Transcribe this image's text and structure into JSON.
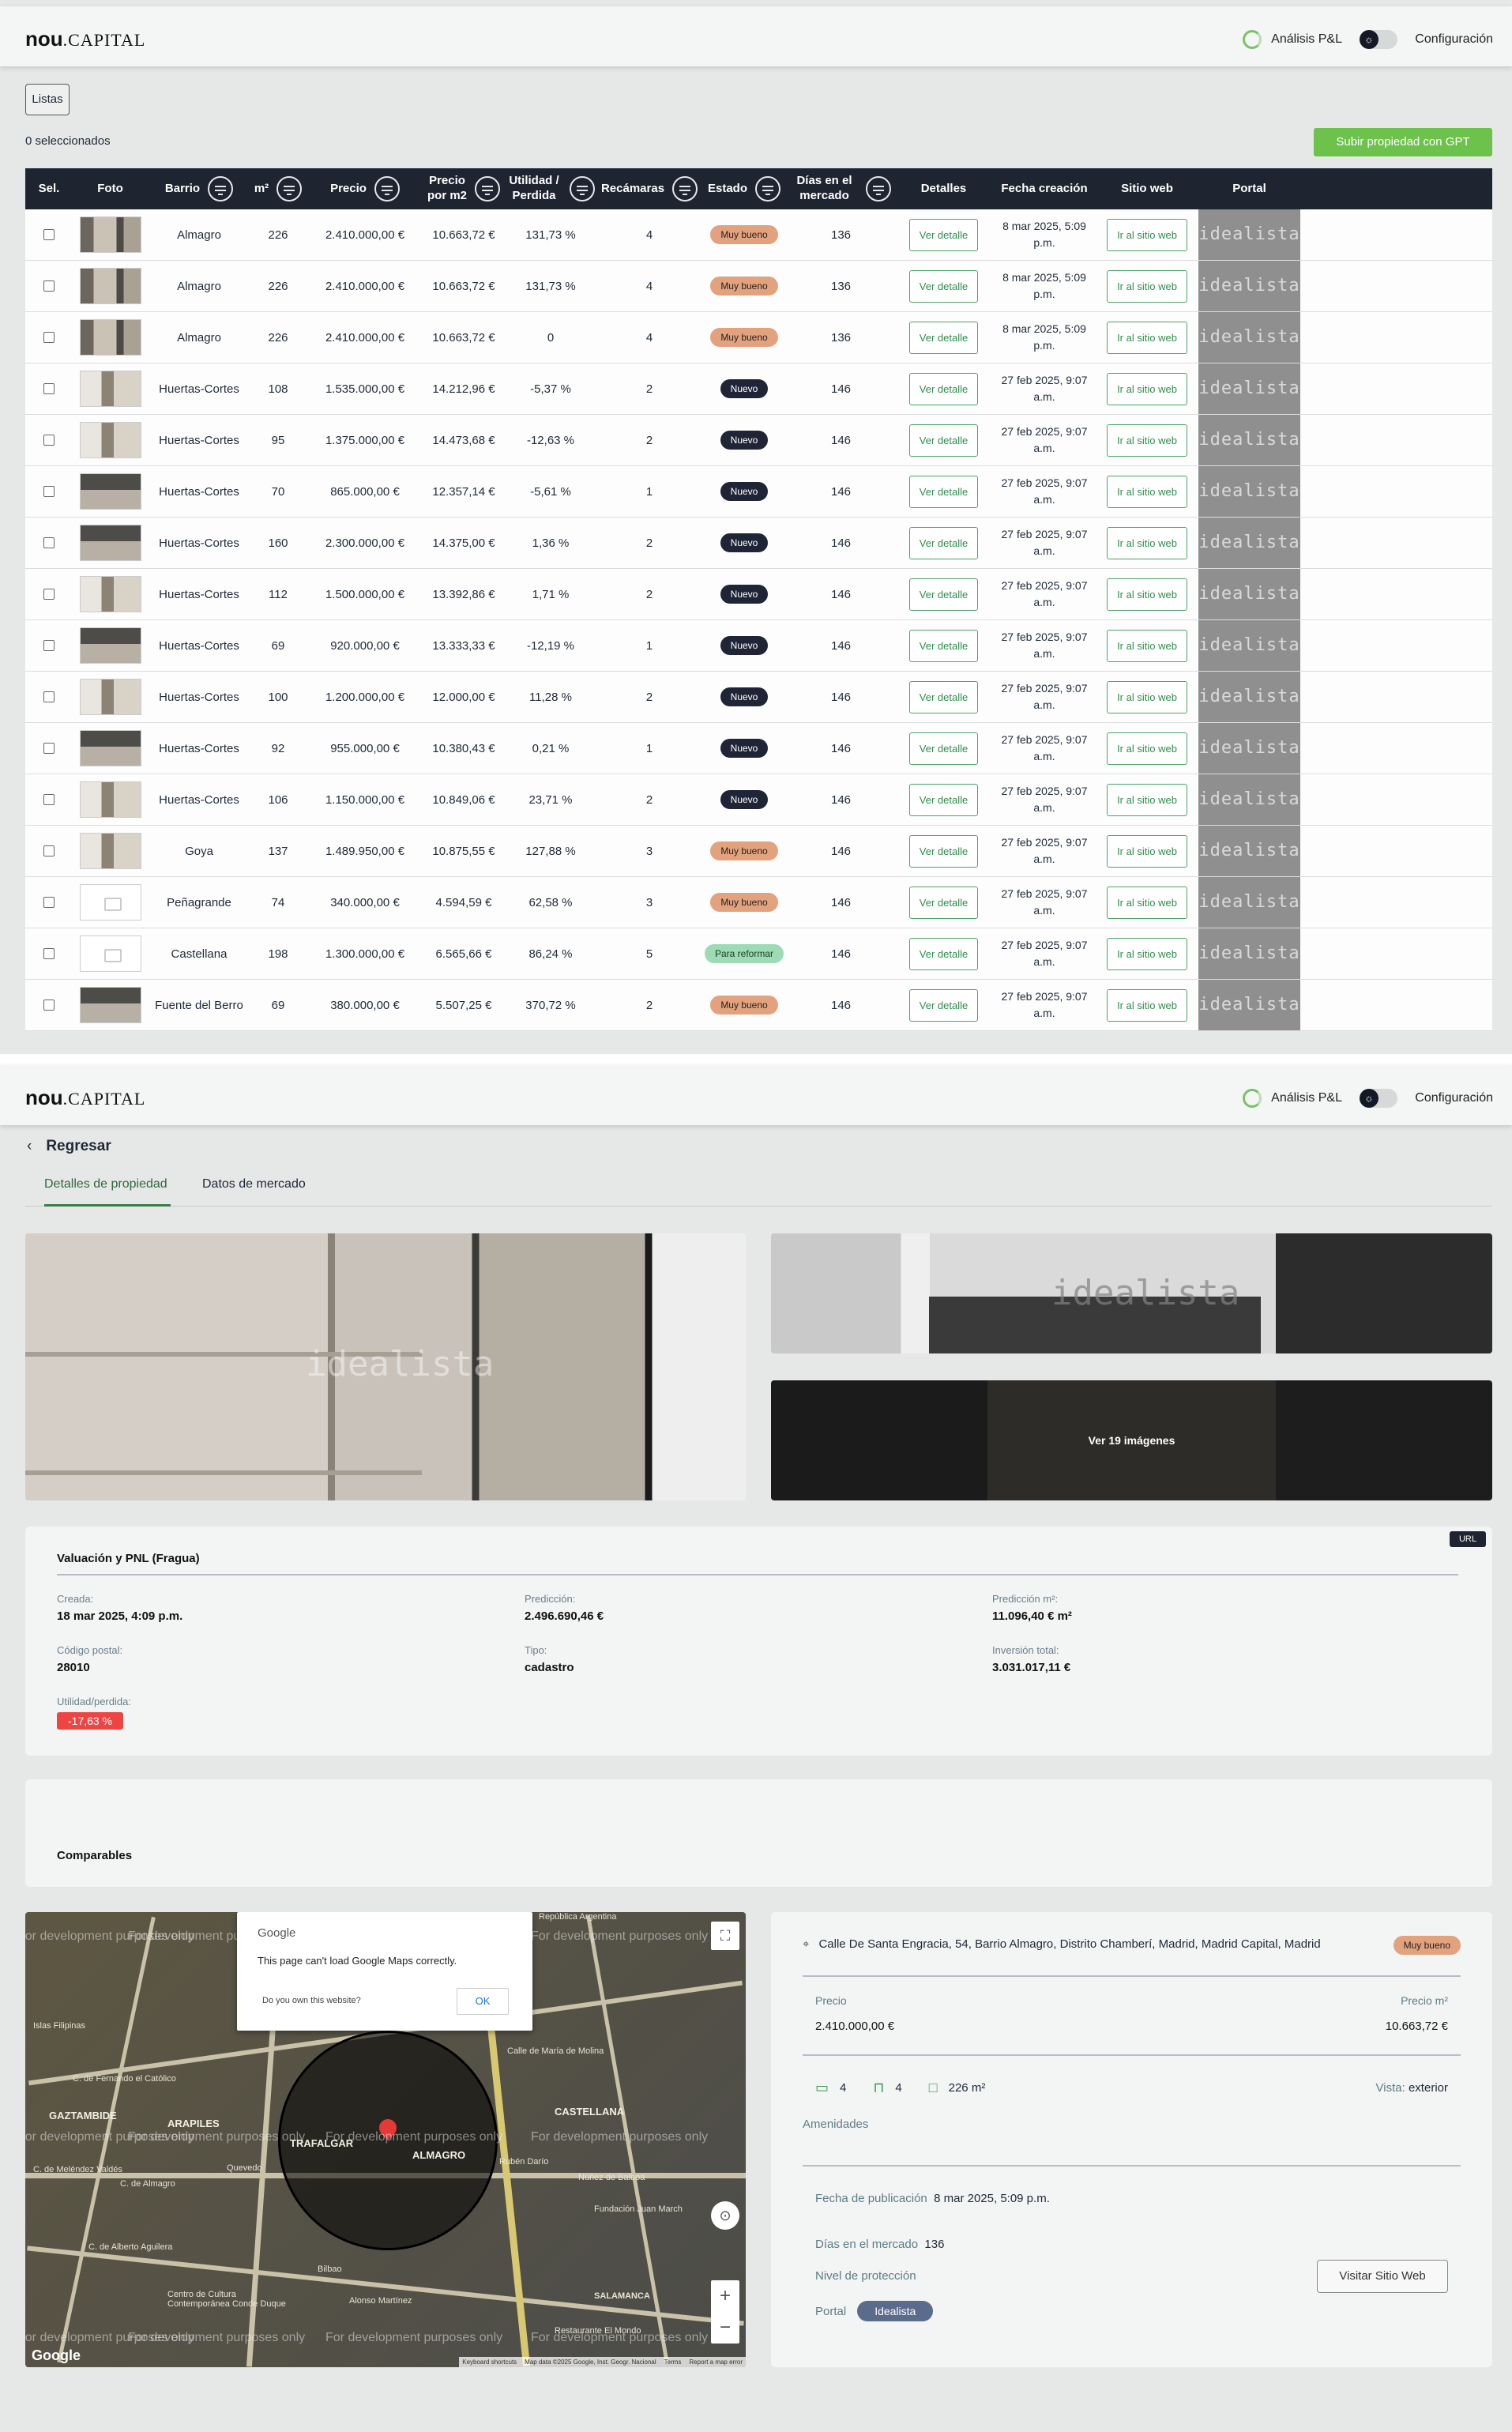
{
  "header": {
    "logo_bold": "nou",
    "logo_rest": ".CAPITAL",
    "pl_analysis": "Análisis P&L",
    "theme_icon": "☼",
    "config": "Configuración"
  },
  "list": {
    "lists_button": "Listas",
    "selected_count": "0 seleccionados",
    "gpt_button": "Subir propiedad con GPT",
    "columns": [
      "Sel.",
      "Foto",
      "Barrio",
      "m²",
      "Precio",
      "Precio por m2",
      "Utilidad / Perdida",
      "Recámaras",
      "Estado",
      "Días en el mercado",
      "Detalles",
      "Fecha creación",
      "Sitio web",
      "Portal"
    ],
    "detail_label": "Ver detalle",
    "site_label": "Ir al sitio web",
    "portal_label": "idealista",
    "rows": [
      {
        "barrio": "Almagro",
        "m2": "226",
        "precio": "2.410.000,00 €",
        "pm2": "10.663,72 €",
        "util": "131,73 %",
        "rec": "4",
        "estado": "Muy bueno",
        "dias": "136",
        "fecha1": "8 mar 2025, 5:09",
        "fecha2": "p.m."
      },
      {
        "barrio": "Almagro",
        "m2": "226",
        "precio": "2.410.000,00 €",
        "pm2": "10.663,72 €",
        "util": "131,73 %",
        "rec": "4",
        "estado": "Muy bueno",
        "dias": "136",
        "fecha1": "8 mar 2025, 5:09",
        "fecha2": "p.m."
      },
      {
        "barrio": "Almagro",
        "m2": "226",
        "precio": "2.410.000,00 €",
        "pm2": "10.663,72 €",
        "util": "0",
        "rec": "4",
        "estado": "Muy bueno",
        "dias": "136",
        "fecha1": "8 mar 2025, 5:09",
        "fecha2": "p.m."
      },
      {
        "barrio": "Huertas-Cortes",
        "m2": "108",
        "precio": "1.535.000,00 €",
        "pm2": "14.212,96 €",
        "util": "-5,37 %",
        "rec": "2",
        "estado": "Nuevo",
        "dias": "146",
        "fecha1": "27 feb 2025, 9:07",
        "fecha2": "a.m."
      },
      {
        "barrio": "Huertas-Cortes",
        "m2": "95",
        "precio": "1.375.000,00 €",
        "pm2": "14.473,68 €",
        "util": "-12,63 %",
        "rec": "2",
        "estado": "Nuevo",
        "dias": "146",
        "fecha1": "27 feb 2025, 9:07",
        "fecha2": "a.m."
      },
      {
        "barrio": "Huertas-Cortes",
        "m2": "70",
        "precio": "865.000,00 €",
        "pm2": "12.357,14 €",
        "util": "-5,61 %",
        "rec": "1",
        "estado": "Nuevo",
        "dias": "146",
        "fecha1": "27 feb 2025, 9:07",
        "fecha2": "a.m."
      },
      {
        "barrio": "Huertas-Cortes",
        "m2": "160",
        "precio": "2.300.000,00 €",
        "pm2": "14.375,00 €",
        "util": "1,36 %",
        "rec": "2",
        "estado": "Nuevo",
        "dias": "146",
        "fecha1": "27 feb 2025, 9:07",
        "fecha2": "a.m."
      },
      {
        "barrio": "Huertas-Cortes",
        "m2": "112",
        "precio": "1.500.000,00 €",
        "pm2": "13.392,86 €",
        "util": "1,71 %",
        "rec": "2",
        "estado": "Nuevo",
        "dias": "146",
        "fecha1": "27 feb 2025, 9:07",
        "fecha2": "a.m."
      },
      {
        "barrio": "Huertas-Cortes",
        "m2": "69",
        "precio": "920.000,00 €",
        "pm2": "13.333,33 €",
        "util": "-12,19 %",
        "rec": "1",
        "estado": "Nuevo",
        "dias": "146",
        "fecha1": "27 feb 2025, 9:07",
        "fecha2": "a.m."
      },
      {
        "barrio": "Huertas-Cortes",
        "m2": "100",
        "precio": "1.200.000,00 €",
        "pm2": "12.000,00 €",
        "util": "11,28 %",
        "rec": "2",
        "estado": "Nuevo",
        "dias": "146",
        "fecha1": "27 feb 2025, 9:07",
        "fecha2": "a.m."
      },
      {
        "barrio": "Huertas-Cortes",
        "m2": "92",
        "precio": "955.000,00 €",
        "pm2": "10.380,43 €",
        "util": "0,21 %",
        "rec": "1",
        "estado": "Nuevo",
        "dias": "146",
        "fecha1": "27 feb 2025, 9:07",
        "fecha2": "a.m."
      },
      {
        "barrio": "Huertas-Cortes",
        "m2": "106",
        "precio": "1.150.000,00 €",
        "pm2": "10.849,06 €",
        "util": "23,71 %",
        "rec": "2",
        "estado": "Nuevo",
        "dias": "146",
        "fecha1": "27 feb 2025, 9:07",
        "fecha2": "a.m."
      },
      {
        "barrio": "Goya",
        "m2": "137",
        "precio": "1.489.950,00 €",
        "pm2": "10.875,55 €",
        "util": "127,88 %",
        "rec": "3",
        "estado": "Muy bueno",
        "dias": "146",
        "fecha1": "27 feb 2025, 9:07",
        "fecha2": "a.m."
      },
      {
        "barrio": "Peñagrande",
        "m2": "74",
        "precio": "340.000,00 €",
        "pm2": "4.594,59 €",
        "util": "62,58 %",
        "rec": "3",
        "estado": "Muy bueno",
        "dias": "146",
        "fecha1": "27 feb 2025, 9:07",
        "fecha2": "a.m."
      },
      {
        "barrio": "Castellana",
        "m2": "198",
        "precio": "1.300.000,00 €",
        "pm2": "6.565,66 €",
        "util": "86,24 %",
        "rec": "5",
        "estado": "Para reformar",
        "dias": "146",
        "fecha1": "27 feb 2025, 9:07",
        "fecha2": "a.m."
      },
      {
        "barrio": "Fuente del Berro",
        "m2": "69",
        "precio": "380.000,00 €",
        "pm2": "5.507,25 €",
        "util": "370,72 %",
        "rec": "2",
        "estado": "Muy bueno",
        "dias": "146",
        "fecha1": "27 feb 2025, 9:07",
        "fecha2": "a.m."
      }
    ]
  },
  "detail": {
    "back": "Regresar",
    "tabs": [
      "Detalles de propiedad",
      "Datos de mercado"
    ],
    "gallery_watermark": "idealista",
    "more_images": "Ver 19 imágenes",
    "valuation": {
      "title": "Valuación y PNL (Fragua)",
      "url_badge": "URL",
      "fields": [
        {
          "label": "Creada:",
          "value": "18 mar 2025, 4:09 p.m."
        },
        {
          "label": "Predicción:",
          "value": "2.496.690,46 €"
        },
        {
          "label": "Predicción m²:",
          "value": "11.096,40 € m²"
        },
        {
          "label": "Código postal:",
          "value": "28010"
        },
        {
          "label": "Tipo:",
          "value": "cadastro"
        },
        {
          "label": "Inversión total:",
          "value": "3.031.017,11 €"
        }
      ],
      "profit_label": "Utilidad/perdida:",
      "profit_value": "-17,63 %"
    },
    "comparables": "Comparables",
    "map": {
      "dialog_brand": "Google",
      "dialog_text": "This page can't load Google Maps correctly.",
      "dialog_question": "Do you own this website?",
      "dialog_ok": "OK",
      "watermark": "For development purposes only",
      "google": "Google",
      "attribution": [
        "Keyboard shortcuts",
        "Map data ©2025 Google, Inst. Geogr. Nacional",
        "Terms",
        "Report a map error"
      ],
      "labels": [
        "GAZTAMBIDE",
        "ARAPILES",
        "TRAFALGAR",
        "ALMAGRO",
        "CASTELLANA",
        "C. de Fernando el Católico",
        "Quevedo",
        "Bilbao",
        "Alonso Martínez",
        "C. de Almagro",
        "Núñez de Balboa",
        "Rubén Darío",
        "Calle de María de Molina",
        "República Argentina",
        "Islas Filipinas",
        "C. de Meléndez Valdés",
        "C. de Alberto Aguilera",
        "Centro de Cultura Contemporánea Conde Duque",
        "Fundación Juan March",
        "Restaurante El Mondo",
        "SALAMANCA"
      ]
    },
    "property": {
      "address": "Calle De Santa Engracia, 54, Barrio Almagro, Distrito Chamberí, Madrid, Madrid Capital, Madrid",
      "status": "Muy bueno",
      "price_label": "Precio",
      "price": "2.410.000,00 €",
      "pm2_label": "Precio m²",
      "pm2": "10.663,72 €",
      "beds": "4",
      "baths": "4",
      "area": "226 m²",
      "view_label": "Vista:",
      "view": "exterior",
      "amenities": "Amenidades",
      "pub_label": "Fecha de publicación",
      "pub": "8 mar 2025, 5:09 p.m.",
      "days_label": "Días en el mercado",
      "days": "136",
      "protection_label": "Nivel de protección",
      "portal_label": "Portal",
      "portal": "Idealista",
      "visit_button": "Visitar Sitio Web"
    }
  },
  "colors": {
    "accent": "#6cc24a",
    "dark": "#1f2431",
    "danger": "#ef4444"
  }
}
